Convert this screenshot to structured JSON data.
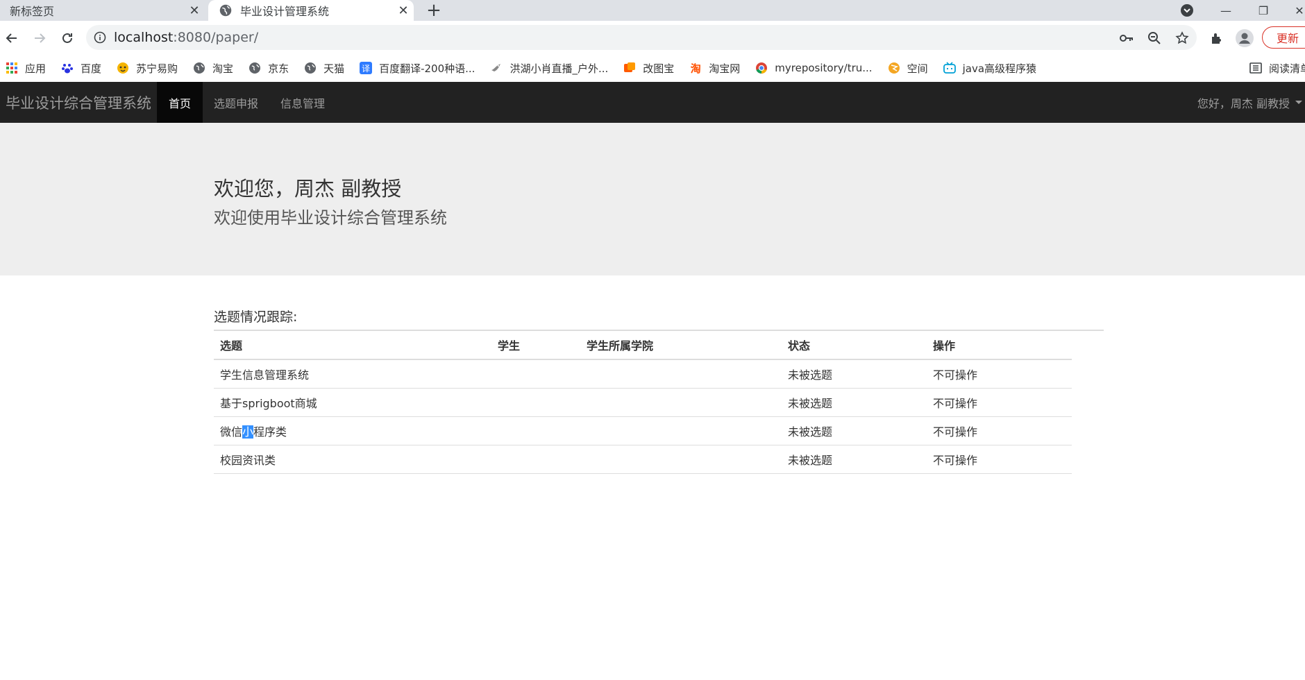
{
  "browser": {
    "tabs": [
      {
        "title": "新标签页",
        "active": false
      },
      {
        "title": "毕业设计管理系统",
        "active": true
      }
    ],
    "url_host": "localhost",
    "url_rest": ":8080/paper/",
    "update_label": "更新",
    "bookmarks": [
      {
        "label": "应用",
        "icon": "apps-grid-icon"
      },
      {
        "label": "百度",
        "icon": "baidu-paw-icon"
      },
      {
        "label": "苏宁易购",
        "icon": "suning-icon"
      },
      {
        "label": "淘宝",
        "icon": "globe-icon"
      },
      {
        "label": "京东",
        "icon": "globe-icon"
      },
      {
        "label": "天猫",
        "icon": "globe-icon"
      },
      {
        "label": "百度翻译-200种语...",
        "icon": "translate-icon"
      },
      {
        "label": "洪湖小肖直播_户外...",
        "icon": "bird-icon"
      },
      {
        "label": "改图宝",
        "icon": "gaitubao-icon"
      },
      {
        "label": "淘宝网",
        "icon": "taobao-icon"
      },
      {
        "label": "myrepository/tru...",
        "icon": "chrome-icon"
      },
      {
        "label": "空间",
        "icon": "qzone-icon"
      },
      {
        "label": "java高级程序猿",
        "icon": "bilibili-icon"
      }
    ],
    "reading_list_label": "阅读清单"
  },
  "navbar": {
    "brand": "毕业设计综合管理系统",
    "items": [
      {
        "label": "首页",
        "active": true
      },
      {
        "label": "选题申报",
        "active": false
      },
      {
        "label": "信息管理",
        "active": false
      }
    ],
    "user": "您好，周杰 副教授"
  },
  "jumbotron": {
    "title": "欢迎您，周杰 副教授",
    "subtitle": "欢迎使用毕业设计综合管理系统"
  },
  "tracking": {
    "title": "选题情况跟踪:",
    "columns": [
      "选题",
      "学生",
      "学生所属学院",
      "状态",
      "操作"
    ],
    "rows": [
      {
        "topic": "学生信息管理系统",
        "student": "",
        "college": "",
        "status": "未被选题",
        "action": "不可操作"
      },
      {
        "topic": "基于sprigboot商城",
        "student": "",
        "college": "",
        "status": "未被选题",
        "action": "不可操作"
      },
      {
        "topic_a": "微信",
        "topic_sel": "小",
        "topic_b": "程序类",
        "student": "",
        "college": "",
        "status": "未被选题",
        "action": "不可操作"
      },
      {
        "topic": "校园资讯类",
        "student": "",
        "college": "",
        "status": "未被选题",
        "action": "不可操作"
      }
    ]
  },
  "colors": {
    "navbar_bg": "#222222",
    "navbar_active": "#080808",
    "jumbotron_bg": "#eeeeee",
    "selection": "#3390ff"
  }
}
